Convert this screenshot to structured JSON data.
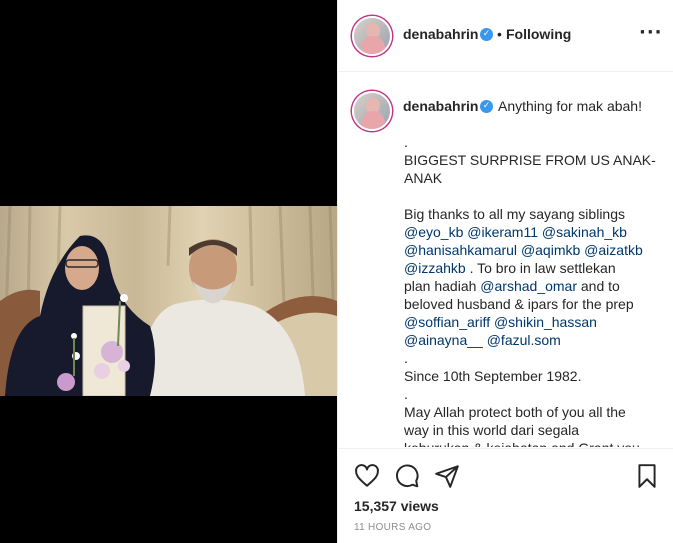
{
  "post": {
    "username": "denabahrin",
    "follow_status": "Following",
    "separator": "•",
    "more_icon": "more-horizontal-icon",
    "verified_icon": "verified-badge-icon"
  },
  "caption": {
    "first_line": "Anything for mak abah!",
    "lines": [
      {
        "type": "text",
        "text": "."
      },
      {
        "type": "text",
        "text": "BIGGEST SURPRISE FROM US ANAK-"
      },
      {
        "type": "text",
        "text": "ANAK"
      },
      {
        "type": "gap"
      },
      {
        "type": "text",
        "text": "Big thanks to all my sayang siblings"
      },
      {
        "type": "rich",
        "parts": [
          {
            "m": true,
            "t": "@eyo_kb"
          },
          {
            "m": false,
            "t": " "
          },
          {
            "m": true,
            "t": "@ikeram11"
          },
          {
            "m": false,
            "t": " "
          },
          {
            "m": true,
            "t": "@sakinah_kb"
          }
        ]
      },
      {
        "type": "rich",
        "parts": [
          {
            "m": true,
            "t": "@hanisahkamarul"
          },
          {
            "m": false,
            "t": " "
          },
          {
            "m": true,
            "t": "@aqimkb"
          },
          {
            "m": false,
            "t": " "
          },
          {
            "m": true,
            "t": "@aizatkb"
          }
        ]
      },
      {
        "type": "rich",
        "parts": [
          {
            "m": true,
            "t": "@izzahkb"
          },
          {
            "m": false,
            "t": " . To bro in law settlekan"
          }
        ]
      },
      {
        "type": "rich",
        "parts": [
          {
            "m": false,
            "t": "plan hadiah "
          },
          {
            "m": true,
            "t": "@arshad_omar"
          },
          {
            "m": false,
            "t": " and to"
          }
        ]
      },
      {
        "type": "text",
        "text": "beloved husband & ipars for the prep"
      },
      {
        "type": "rich",
        "parts": [
          {
            "m": true,
            "t": "@soffian_ariff"
          },
          {
            "m": false,
            "t": " "
          },
          {
            "m": true,
            "t": "@shikin_hassan"
          }
        ]
      },
      {
        "type": "rich",
        "parts": [
          {
            "m": true,
            "t": "@ainayna__"
          },
          {
            "m": false,
            "t": " "
          },
          {
            "m": true,
            "t": "@fazul.som"
          }
        ]
      },
      {
        "type": "text",
        "text": "."
      },
      {
        "type": "text",
        "text": "Since 10th September 1982."
      },
      {
        "type": "text",
        "text": "."
      },
      {
        "type": "text",
        "text": "May Allah protect both of you all the"
      },
      {
        "type": "text",
        "text": "way in this world dari segala"
      },
      {
        "type": "cut",
        "text": "keburukan & kejahatan and Grant you"
      }
    ]
  },
  "actions": {
    "like_icon": "heart-icon",
    "comment_icon": "comment-icon",
    "share_icon": "share-icon",
    "save_icon": "bookmark-icon"
  },
  "views": "15,357 views",
  "timestamp": "11 HOURS AGO",
  "colors": {
    "mention": "#00376b",
    "verified": "#3897f0",
    "story_ring": "#c13584",
    "border": "#efefef",
    "muted": "#8e8e8e"
  }
}
